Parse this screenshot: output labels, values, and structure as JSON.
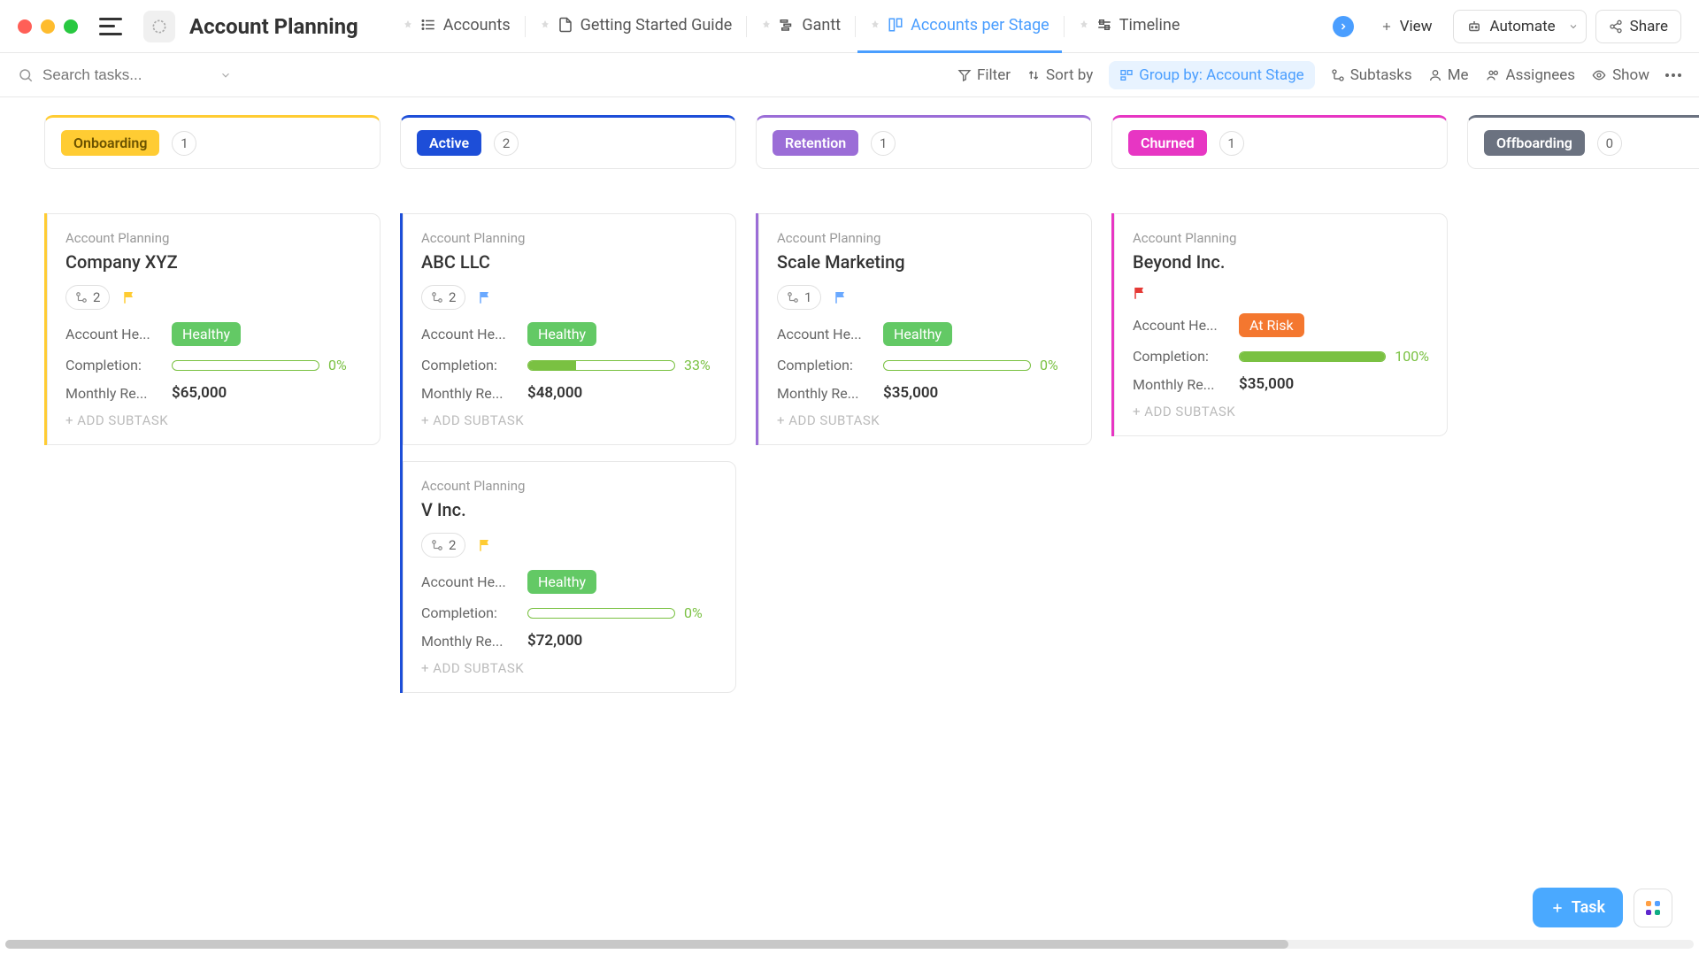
{
  "page_title": "Account Planning",
  "tabs": [
    {
      "label": "Accounts",
      "icon": "list"
    },
    {
      "label": "Getting Started Guide",
      "icon": "doc"
    },
    {
      "label": "Gantt",
      "icon": "gantt"
    },
    {
      "label": "Accounts per Stage",
      "icon": "board",
      "active": true
    },
    {
      "label": "Timeline",
      "icon": "timeline"
    }
  ],
  "top_actions": {
    "view": "View",
    "automate": "Automate",
    "share": "Share"
  },
  "search": {
    "placeholder": "Search tasks..."
  },
  "toolbar": {
    "filter": "Filter",
    "sort": "Sort by",
    "group": "Group by: Account Stage",
    "subtasks": "Subtasks",
    "me": "Me",
    "assignees": "Assignees",
    "show": "Show"
  },
  "fields": {
    "health": "Account He...",
    "completion": "Completion:",
    "revenue": "Monthly Re..."
  },
  "add_subtask": "+ ADD SUBTASK",
  "fab": {
    "task": "Task"
  },
  "columns": [
    {
      "name": "Onboarding",
      "count": "1",
      "badge_bg": "#ffcc33",
      "badge_fg": "#6b5200",
      "col": "#ffcc33",
      "cards": [
        {
          "folder": "Account Planning",
          "title": "Company XYZ",
          "subtasks": "2",
          "flag": "#ffcc33",
          "health": "Healthy",
          "health_bg": "#63c965",
          "completion": "0%",
          "comp_pct": 0,
          "revenue": "$65,000"
        }
      ]
    },
    {
      "name": "Active",
      "count": "2",
      "badge_bg": "#1d4ed8",
      "badge_fg": "#fff",
      "col": "#1d4ed8",
      "cards": [
        {
          "folder": "Account Planning",
          "title": "ABC LLC",
          "subtasks": "2",
          "flag": "#6aa9ff",
          "health": "Healthy",
          "health_bg": "#63c965",
          "completion": "33%",
          "comp_pct": 33,
          "revenue": "$48,000"
        },
        {
          "folder": "Account Planning",
          "title": "V Inc.",
          "subtasks": "2",
          "flag": "#ffcc33",
          "health": "Healthy",
          "health_bg": "#63c965",
          "completion": "0%",
          "comp_pct": 0,
          "revenue": "$72,000"
        }
      ]
    },
    {
      "name": "Retention",
      "count": "1",
      "badge_bg": "#9b6dd7",
      "badge_fg": "#fff",
      "col": "#9b6dd7",
      "cards": [
        {
          "folder": "Account Planning",
          "title": "Scale Marketing",
          "subtasks": "1",
          "flag": "#6aa9ff",
          "health": "Healthy",
          "health_bg": "#63c965",
          "completion": "0%",
          "comp_pct": 0,
          "revenue": "$35,000"
        }
      ]
    },
    {
      "name": "Churned",
      "count": "1",
      "badge_bg": "#e736c3",
      "badge_fg": "#fff",
      "col": "#e736c3",
      "cards": [
        {
          "folder": "Account Planning",
          "title": "Beyond Inc.",
          "subtasks": null,
          "flag": "#e53935",
          "health": "At Risk",
          "health_bg": "#f4772f",
          "completion": "100%",
          "comp_pct": 100,
          "revenue": "$35,000"
        }
      ]
    },
    {
      "name": "Offboarding",
      "count": "0",
      "badge_bg": "#6b7280",
      "badge_fg": "#fff",
      "col": "#6b7280",
      "cards": []
    }
  ]
}
